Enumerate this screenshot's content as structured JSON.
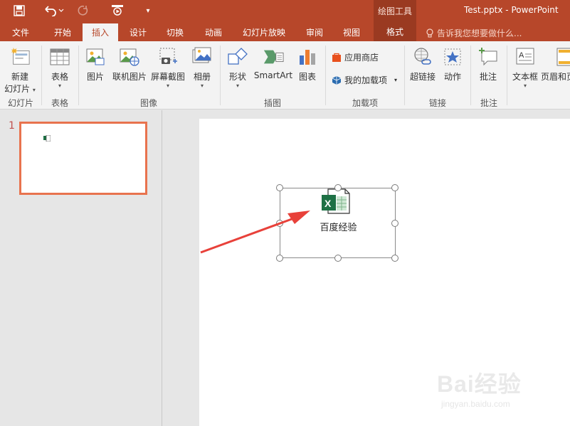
{
  "titlebar": {
    "context_label": "绘图工具",
    "window_title": "Test.pptx - PowerPoint"
  },
  "tabs": [
    {
      "label": "文件"
    },
    {
      "label": "开始"
    },
    {
      "label": "插入"
    },
    {
      "label": "设计"
    },
    {
      "label": "切换"
    },
    {
      "label": "动画"
    },
    {
      "label": "幻灯片放映"
    },
    {
      "label": "审阅"
    },
    {
      "label": "视图"
    },
    {
      "label": "格式"
    }
  ],
  "active_tab": "插入",
  "tellme": "告诉我您想要做什么...",
  "ribbon": {
    "slides": {
      "new_slide": "新建",
      "new_slide2": "幻灯片",
      "group": "幻灯片"
    },
    "tables": {
      "table": "表格",
      "group": "表格"
    },
    "images": {
      "picture": "图片",
      "online_picture": "联机图片",
      "screenshot": "屏幕截图",
      "album": "相册",
      "group": "图像"
    },
    "illustrations": {
      "shapes": "形状",
      "smartart": "SmartArt",
      "chart": "图表",
      "group": "插图"
    },
    "addins": {
      "store": "应用商店",
      "my_addins": "我的加载项",
      "group": "加载项"
    },
    "links": {
      "hyperlink": "超链接",
      "action": "动作",
      "group": "链接"
    },
    "comments": {
      "comment": "批注",
      "group": "批注"
    },
    "text": {
      "textbox": "文本框",
      "header_footer": "页眉和页"
    }
  },
  "thumbnails": {
    "slide_number": "1"
  },
  "slide": {
    "object_label": "百度经验"
  },
  "watermark": {
    "brand": "Bai经验",
    "url": "jingyan.baidu.com"
  },
  "colors": {
    "accent": "#b7472a",
    "thumb_border": "#e8734e",
    "arrow": "#e8413a",
    "excel_green": "#1e7145"
  }
}
